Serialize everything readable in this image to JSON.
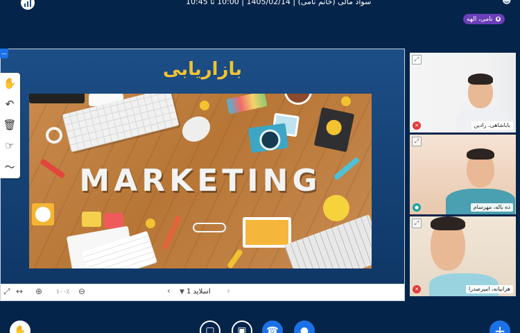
{
  "header": {
    "session_title": "سواد مالی (خانم نامی) | 1405/02/14 | 10:00 تا 10:45",
    "current_speaker": "نامی، الهه"
  },
  "presentation": {
    "slide_title": "بازاریابی",
    "slide_image_text": "MARKETING",
    "slide_selector": "اسلاید 1",
    "zoom_level": "۱۰۰٪"
  },
  "participants": [
    {
      "name": "باباشاهی، رادین",
      "mic_status": "muted",
      "status_color": "#e23b3b"
    },
    {
      "name": "ده باله، مهرسام",
      "mic_status": "headset",
      "status_color": "#14a3a3"
    },
    {
      "name": "هرانیانه، امیرصدرا",
      "mic_status": "muted",
      "status_color": "#e23b3b"
    }
  ],
  "colors": {
    "background": "#05244a",
    "accent": "#1b72e8",
    "speaker_badge": "#6a3fb8",
    "slide_title": "#f2c230"
  },
  "icons": {
    "toolbar": [
      "hand-icon",
      "undo-icon",
      "trash-icon",
      "pointer-hand-icon",
      "chart-icon"
    ],
    "bottom": [
      "raise-hand-icon",
      "share-screen-icon",
      "presentation-icon",
      "phone-icon",
      "microphone-icon",
      "plus-icon"
    ]
  }
}
